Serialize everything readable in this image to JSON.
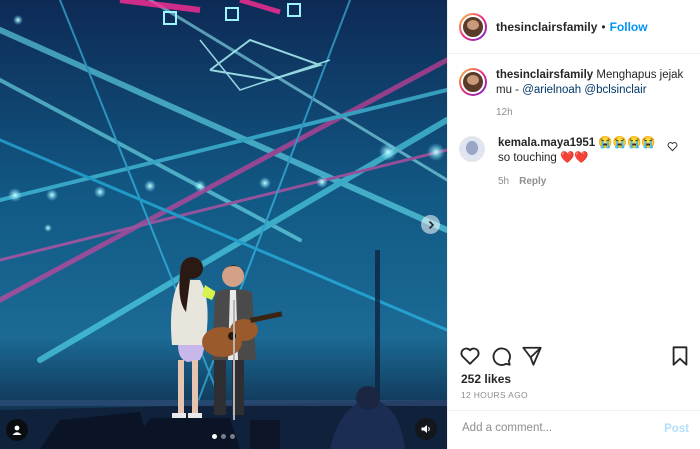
{
  "post": {
    "username": "thesinclairsfamily",
    "follow_label": "Follow",
    "separator": "•",
    "caption_text": "Menghapus jejak mu - ",
    "mentions": [
      "@arielnoah",
      "@bclsinclair"
    ],
    "caption_time": "12h",
    "likes": "252 likes",
    "posted_ago": "12 HOURS AGO",
    "slide_count": 3,
    "active_slide": 1
  },
  "comments": [
    {
      "username": "kemala.maya1951",
      "text_before": "😭😭😭😭 so touching",
      "hearts": "❤️❤️",
      "time": "5h",
      "reply_label": "Reply"
    }
  ],
  "add_comment": {
    "placeholder": "Add a comment...",
    "post_label": "Post"
  },
  "icons": [
    "heart-icon",
    "comment-icon",
    "share-icon",
    "bookmark-icon",
    "chevron-right-icon",
    "user-tag-icon",
    "sound-icon"
  ],
  "colors": {
    "follow": "#0095f6",
    "post_disabled": "#b2dffc",
    "meta": "#8e8e8e",
    "text": "#262626"
  }
}
